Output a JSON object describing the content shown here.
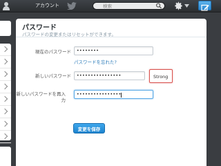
{
  "topbar": {
    "account_label": "アカウント",
    "search_placeholder": "検索",
    "icons": [
      "person-icon",
      "bird-icon",
      "search-icon",
      "gear-icon",
      "compose-icon"
    ],
    "colors": {
      "bar": "#2b2e31",
      "accent": "#2a88d2"
    }
  },
  "settings": {
    "title": "パスワード",
    "subtitle": "パスワードの変更またはリセットができます。",
    "fields": [
      {
        "label": "現在のパスワード",
        "value": "••••••••"
      },
      {
        "label": "新しいパスワード",
        "value": "••••••••••••••••"
      },
      {
        "label": "新しいパスワードを再入力",
        "value": "••••••••••••••••"
      }
    ],
    "forgot_link": "パスワードを忘れた?",
    "strength": "Strong",
    "save_label": "変更を保存",
    "colors": {
      "strength_border": "#d9534f",
      "button": "#1d84cf",
      "link": "#2b7bb9"
    }
  }
}
